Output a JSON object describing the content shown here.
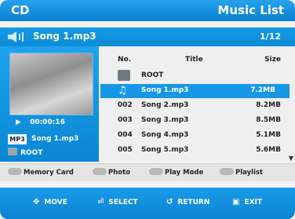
{
  "header": {
    "source": "CD",
    "title": "Music List"
  },
  "now_playing": {
    "song": "Song 1.mp3",
    "track_counter": "1/12"
  },
  "left_panel": {
    "elapsed": "00:00:16",
    "format_tag": "MP3",
    "current_song": "Song 1.mp3",
    "folder": "ROOT"
  },
  "list": {
    "columns": {
      "no": "No.",
      "title": "Title",
      "size": "Size"
    },
    "root_label": "ROOT",
    "rows": [
      {
        "no": "",
        "title": "Song 1.mp3",
        "size": "7.2MB"
      },
      {
        "no": "002",
        "title": "Song 2.mp3",
        "size": "8.2MB"
      },
      {
        "no": "003",
        "title": "Song 3.mp3",
        "size": "8.5MB"
      },
      {
        "no": "004",
        "title": "Song 4.mp3",
        "size": "5.1MB"
      },
      {
        "no": "005",
        "title": "Song 5.mp3",
        "size": "5.6MB"
      }
    ]
  },
  "options": {
    "memory_card": "Memory Card",
    "photo": "Photo",
    "play_mode": "Play Mode",
    "playlist": "Playlist"
  },
  "nav": {
    "move": "MOVE",
    "select": "SELECT",
    "return": "RETURN",
    "exit": "EXIT"
  },
  "colors": {
    "accent": "#0c8fdc",
    "selected_row": "#1897e6"
  }
}
